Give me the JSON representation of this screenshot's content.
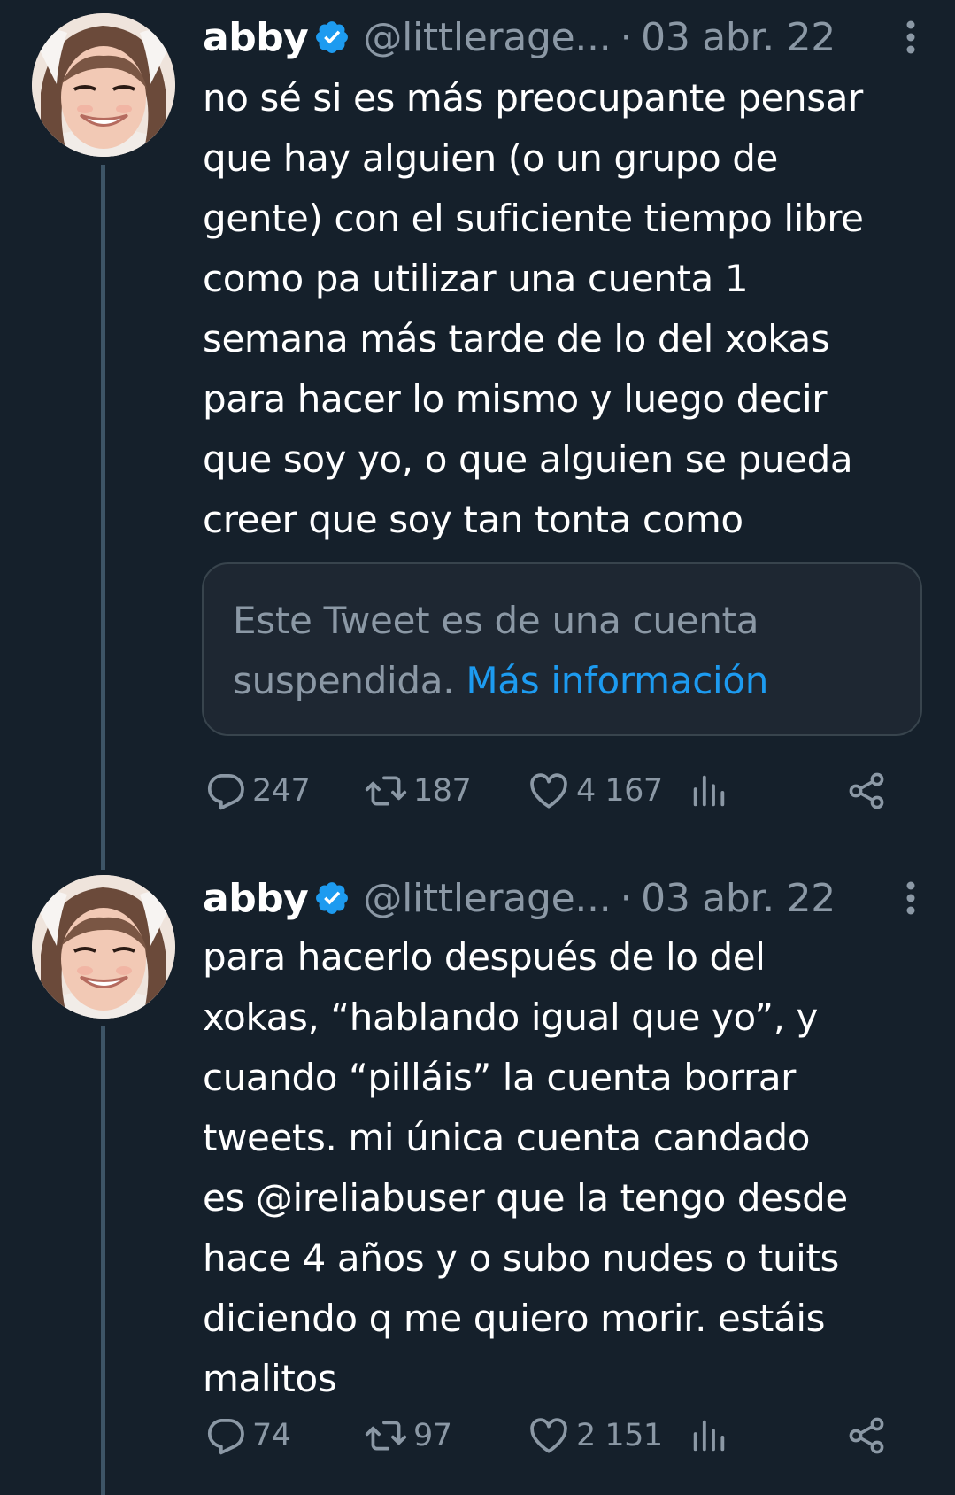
{
  "tweets": [
    {
      "name": "abby",
      "handle": "@littlerage...",
      "separator": "·",
      "date": "03 abr. 22",
      "icons": [
        "avatar-photo",
        "verified-badge-icon",
        "more-options-icon"
      ],
      "text_lines": [
        "no sé si es más preocupante pensar",
        "que hay alguien (o un grupo de",
        "gente) con el suficiente tiempo libre",
        "como pa utilizar una cuenta 1",
        "semana más tarde de lo del xokas",
        "para hacer lo mismo y luego decir",
        "que soy yo, o que alguien se pueda",
        "creer que soy tan tonta como"
      ],
      "quote": {
        "line1": "Este Tweet es de una cuenta",
        "line2_prefix": "suspendida.",
        "link": "Más información"
      },
      "actions": {
        "replies": "247",
        "retweets": "187",
        "likes": "4 167"
      }
    },
    {
      "name": "abby",
      "handle": "@littlerage...",
      "separator": "·",
      "date": "03 abr. 22",
      "icons": [
        "avatar-photo",
        "verified-badge-icon",
        "more-options-icon"
      ],
      "text_lines": [
        "para hacerlo después de lo del",
        "xokas, “hablando igual que yo”, y",
        "cuando “pilláis” la cuenta borrar",
        "tweets. mi única cuenta candado",
        "es @ireliabuser que la tengo desde",
        "hace 4 años y o subo nudes o tuits",
        "diciendo q me quiero morir. estáis",
        "malitos"
      ],
      "actions": {
        "replies": "74",
        "retweets": "97",
        "likes": "2 151"
      }
    }
  ],
  "action_icons": [
    "reply-icon",
    "retweet-icon",
    "like-icon",
    "analytics-icon",
    "share-icon"
  ],
  "colors": {
    "background": "#15202b",
    "text": "#ffffff",
    "muted": "#8b98a5",
    "link": "#1d9bf0",
    "verified": "#1d9bf0",
    "border": "#38444d"
  }
}
